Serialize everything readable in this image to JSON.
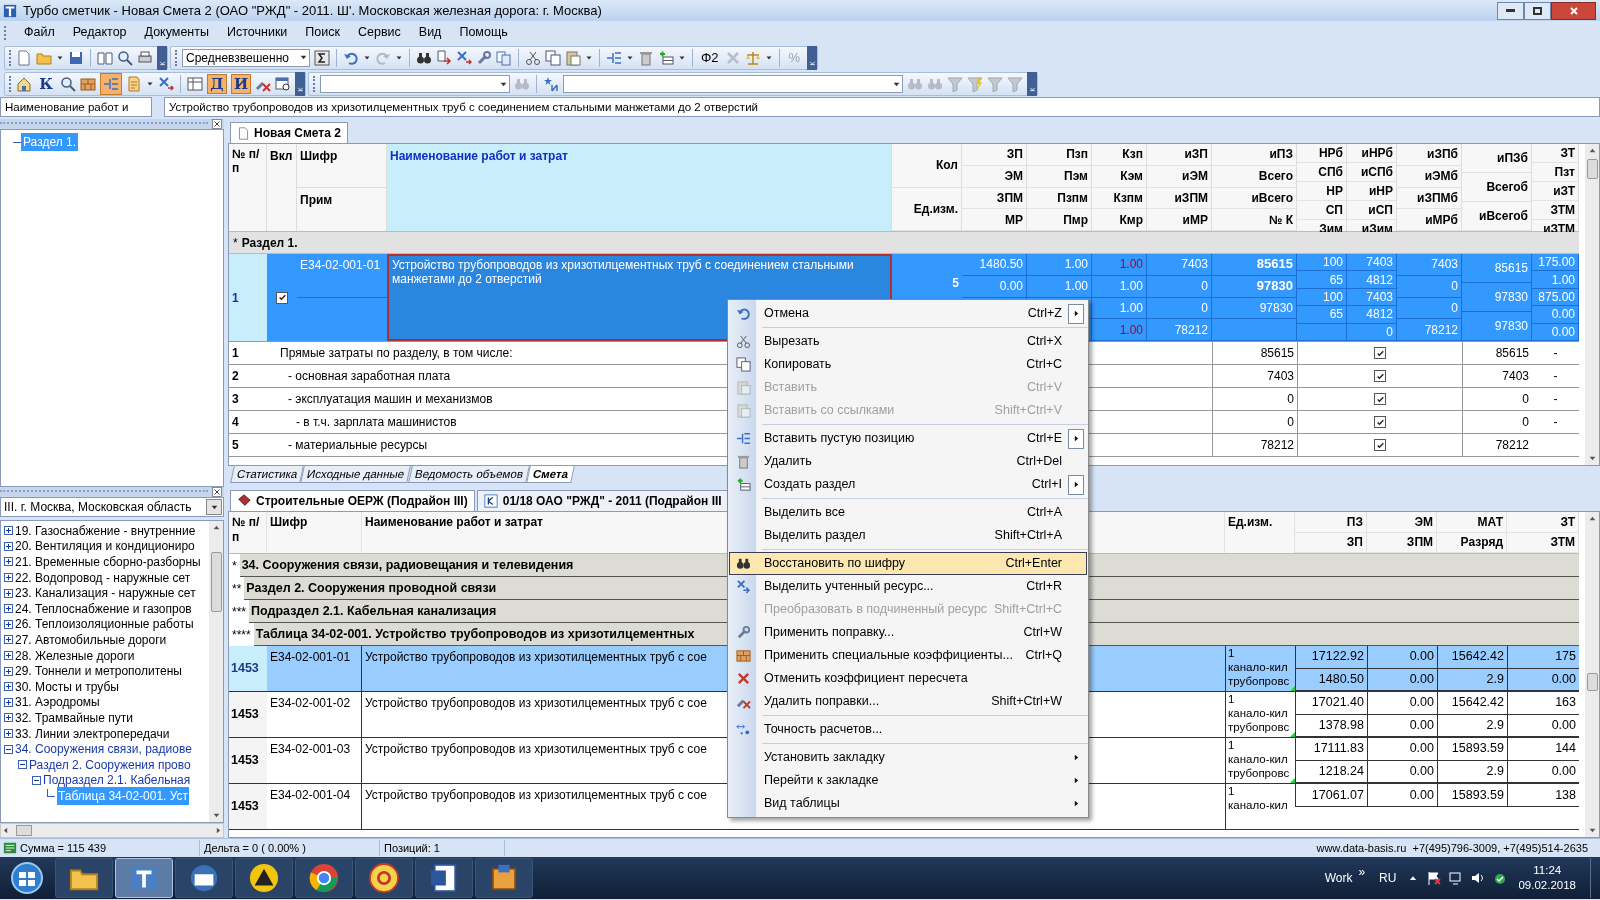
{
  "window": {
    "title": "Турбо сметчик - Новая Смета 2 (ОАО \"РЖД\" - 2011. Ш'. Московская железная дорога: г. Москва)"
  },
  "menu": [
    {
      "label": "Файл"
    },
    {
      "label": "Редактор"
    },
    {
      "label": "Документы"
    },
    {
      "label": "Источники"
    },
    {
      "label": "Поиск"
    },
    {
      "label": "Сервис"
    },
    {
      "label": "Вид"
    },
    {
      "label": "Помощь"
    }
  ],
  "toolbar1": {
    "method_combo": "Средневзвешенно",
    "phi_label": "Φ2",
    "percent_label": "%"
  },
  "toolbar2": {
    "outline_pressed": true,
    "toggles": [
      {
        "label": "К",
        "pressed": false
      },
      {
        "label": "Д",
        "pressed": true
      },
      {
        "label": "И",
        "pressed": true
      }
    ]
  },
  "name_bar": {
    "label": "Наименование работ и",
    "value": "Устройство трубопроводов из хризотилцементных труб с соединением стальными манжетами до 2 отверстий"
  },
  "estimate_tree": [
    {
      "label": "Раздел 1.",
      "selected": true
    }
  ],
  "estimate_tab": {
    "title": "Новая Смета 2"
  },
  "estimate_table": {
    "headers": {
      "num": "№ п/п",
      "incl": "Вкл",
      "code": "Шифр",
      "note": "Прим",
      "name": "Наименование работ и затрат"
    },
    "columns": [
      {
        "labels": [
          "Кол",
          "Ед.изм."
        ]
      },
      {
        "labels": [
          "ЗП",
          "ЭМ",
          "ЗПМ",
          "МР"
        ]
      },
      {
        "labels": [
          "Пзп",
          "Пэм",
          "Пзпм",
          "Пмр"
        ]
      },
      {
        "labels": [
          "Кзп",
          "Кэм",
          "Кзпм",
          "Кмр"
        ]
      },
      {
        "labels": [
          "иЗП",
          "иЭМ",
          "иЗПМ",
          "иМР"
        ]
      },
      {
        "labels": [
          "иПЗ",
          "Всего",
          "иВсего",
          "№ К"
        ]
      },
      {
        "labels": [
          "НРб",
          "СПб",
          "НР",
          "СП",
          "Зим"
        ]
      },
      {
        "labels": [
          "иНРб",
          "иСПб",
          "иНР",
          "иСП",
          "иЗим"
        ]
      },
      {
        "labels": [
          "иЗПб",
          "иЭМб",
          "иЗПМб",
          "иМРб"
        ]
      },
      {
        "labels": [
          "иПЗб",
          "Всегоб",
          "иВсегоб"
        ]
      },
      {
        "labels": [
          "ЗТ",
          "Пзт",
          "иЗТ",
          "ЗТМ",
          "иЗТМ"
        ]
      }
    ],
    "section": {
      "marker": "*",
      "title": "Раздел 1."
    },
    "rows": [
      {
        "num": "1",
        "included": true,
        "selected": true,
        "code": "Е34-02-001-01",
        "name": "Устройство трубопроводов из хризотилцементных труб с соединением стальными манжетами до 2 отверстий",
        "values": [
          [
            "5"
          ],
          [
            "1480.50",
            "0.00"
          ],
          [
            "1.00",
            "1.00"
          ],
          [
            {
              "text": "1.00",
              "flagged": true
            },
            {
              "text": "1.00",
              "flagged": false
            },
            {
              "text": "1.00",
              "flagged": false
            },
            {
              "text": "1.00",
              "flagged": true
            }
          ],
          [
            "7403",
            "0",
            "0",
            "78212"
          ],
          [
            "85615",
            "97830",
            "97830"
          ],
          [
            "100",
            "65",
            "100",
            "65"
          ],
          [
            "7403",
            "4812",
            "7403",
            "4812",
            "0"
          ],
          [
            "7403",
            "0",
            "0",
            "78212"
          ],
          [
            "85615",
            "97830",
            "97830"
          ],
          [
            "175.00",
            "1.00",
            "875.00",
            "0.00",
            "0.00"
          ]
        ]
      }
    ],
    "summary": [
      {
        "num": "1",
        "label": "Прямые затраты по разделу, в том числе:",
        "value": "85615",
        "included": true,
        "total": "85615",
        "dash": "-",
        "children": [
          {
            "num": "2",
            "label": "- основная заработная плата",
            "value": "7403",
            "included": true,
            "total": "7403",
            "dash": "-"
          },
          {
            "num": "3",
            "label": "- эксплуатация машин и механизмов",
            "value": "0",
            "included": true,
            "total": "0",
            "dash": "-",
            "children": [
              {
                "num": "4",
                "label": "- в т.ч. зарплата машинистов",
                "value": "0",
                "included": true,
                "total": "0",
                "dash": "-"
              }
            ]
          },
          {
            "num": "5",
            "label": "- материальные ресурсы",
            "value": "78212",
            "included": true,
            "total": "78212"
          }
        ]
      }
    ]
  },
  "bottom_tabs": [
    {
      "label": "Статистика",
      "selected": false
    },
    {
      "label": "Исходные данные",
      "selected": false
    },
    {
      "label": "Ведомость объемов",
      "selected": false
    },
    {
      "label": "Смета",
      "selected": true
    }
  ],
  "region_combo": "III. г. Москва, Московская область",
  "catalog_tree": [
    {
      "label": "19. Газоснабжение - внутренние",
      "expanded": false,
      "selected": false
    },
    {
      "label": "20. Вентиляция и кондициониро",
      "expanded": false,
      "selected": false
    },
    {
      "label": "21. Временные сборно-разборны",
      "expanded": false,
      "selected": false
    },
    {
      "label": "22. Водопровод - наружные сет",
      "expanded": false,
      "selected": false
    },
    {
      "label": "23. Канализация - наружные сет",
      "expanded": false,
      "selected": false
    },
    {
      "label": "24. Теплоснабжение и газопров",
      "expanded": false,
      "selected": false
    },
    {
      "label": "26. Теплоизоляционные работы",
      "expanded": false,
      "selected": false
    },
    {
      "label": "27. Автомобильные дороги",
      "expanded": false,
      "selected": false
    },
    {
      "label": "28. Железные дороги",
      "expanded": false,
      "selected": false
    },
    {
      "label": "29. Тоннели и метрополитены",
      "expanded": false,
      "selected": false
    },
    {
      "label": "30. Мосты и трубы",
      "expanded": false,
      "selected": false
    },
    {
      "label": "31. Аэродромы",
      "expanded": false,
      "selected": false
    },
    {
      "label": "32. Трамвайные пути",
      "expanded": false,
      "selected": false
    },
    {
      "label": "33. Линии электропередачи",
      "expanded": false,
      "selected": false
    },
    {
      "label": "34. Сооружения связи, радиове",
      "expanded": true,
      "selected": false,
      "children": [
        {
          "label": "Раздел 2. Сооружения прово",
          "expanded": true,
          "selected": false,
          "children": [
            {
              "label": "Подраздел 2.1. Кабельная",
              "expanded": true,
              "selected": false,
              "children": [
                {
                  "label": "Таблица 34-02-001. Уст",
                  "selected": true
                }
              ]
            }
          ]
        }
      ]
    }
  ],
  "lower_tabs": [
    {
      "label": "Строительные ОЕРЖ (Подрайон III)",
      "selected": true
    },
    {
      "label": "01/18 ОАО \"РЖД\" - 2011 (Подрайон III",
      "selected": false
    }
  ],
  "catalog_table": {
    "columns": [
      {
        "labels": [
          "№ п/п"
        ]
      },
      {
        "labels": [
          "Шифр"
        ]
      },
      {
        "labels": [
          "Наименование работ и затрат"
        ]
      },
      {
        "labels": [
          "Ед.изм."
        ]
      },
      {
        "labels": [
          "ПЗ",
          "ЗП"
        ]
      },
      {
        "labels": [
          "ЭМ",
          "ЗПМ"
        ]
      },
      {
        "labels": [
          "МАТ",
          "Разряд"
        ]
      },
      {
        "labels": [
          "ЗТ",
          "ЗТМ"
        ]
      }
    ],
    "groups": [
      {
        "marker": "*",
        "title": "34. Сооружения связи, радиовещания и телевидения",
        "children": [
          {
            "marker": "**",
            "title": "Раздел 2. Сооружения проводной связи",
            "children": [
              {
                "marker": "***",
                "title": "Подраздел 2.1. Кабельная канализация",
                "children": [
                  {
                    "marker": "****",
                    "title": "Таблица 34-02-001. Устройство трубопроводов из хризотилцементных"
                  }
                ]
              }
            ]
          }
        ]
      }
    ],
    "rows": [
      {
        "num": "1453",
        "code": "Е34-02-001-01",
        "name": "Устройство трубопроводов из хризотилцементных труб с сое",
        "selected": true,
        "unit": [
          "1",
          "канало-кил",
          "трубопровс"
        ],
        "values": [
          [
            "17122.92",
            "1480.50"
          ],
          [
            "0.00",
            "0.00"
          ],
          [
            "15642.42",
            "2.9"
          ],
          [
            "175",
            "0.00"
          ]
        ]
      },
      {
        "num": "1453",
        "code": "Е34-02-001-02",
        "name": "Устройство трубопроводов из хризотилцементных труб с сое",
        "selected": false,
        "unit": [
          "1",
          "канало-кил",
          "трубопровс"
        ],
        "values": [
          [
            "17021.40",
            "1378.98"
          ],
          [
            "0.00",
            "0.00"
          ],
          [
            "15642.42",
            "2.9"
          ],
          [
            "163",
            "0.00"
          ]
        ]
      },
      {
        "num": "1453",
        "code": "Е34-02-001-03",
        "name": "Устройство трубопроводов из хризотилцементных труб с сое",
        "selected": false,
        "unit": [
          "1",
          "канало-кил",
          "трубопровс"
        ],
        "values": [
          [
            "17111.83",
            "1218.24"
          ],
          [
            "0.00",
            "0.00"
          ],
          [
            "15893.59",
            "2.9"
          ],
          [
            "144",
            "0.00"
          ]
        ]
      },
      {
        "num": "1453",
        "code": "Е34-02-001-04",
        "name": "Устройство трубопроводов из хризотилцементных труб с сое",
        "selected": false,
        "unit": [
          "1",
          "канало-кил"
        ],
        "values": [
          [
            "17061.07"
          ],
          [
            "0.00"
          ],
          [
            "15893.59"
          ],
          [
            "138"
          ]
        ]
      }
    ]
  },
  "context_menu": [
    {
      "kind": "item",
      "label": "Отмена",
      "shortcut": "Ctrl+Z",
      "submenu": true,
      "boxed": true,
      "disabled": false,
      "selected": false
    },
    {
      "kind": "separator"
    },
    {
      "kind": "item",
      "label": "Вырезать",
      "shortcut": "Ctrl+X",
      "disabled": false,
      "selected": false
    },
    {
      "kind": "item",
      "label": "Копировать",
      "shortcut": "Ctrl+C",
      "disabled": false,
      "selected": false
    },
    {
      "kind": "item",
      "label": "Вставить",
      "shortcut": "Ctrl+V",
      "disabled": true,
      "selected": false
    },
    {
      "kind": "item",
      "label": "Вставить со ссылками",
      "shortcut": "Shift+Ctrl+V",
      "disabled": true,
      "selected": false
    },
    {
      "kind": "separator"
    },
    {
      "kind": "item",
      "label": "Вставить пустую позицию",
      "shortcut": "Ctrl+E",
      "submenu": true,
      "boxed": true,
      "disabled": false,
      "selected": false
    },
    {
      "kind": "item",
      "label": "Удалить",
      "shortcut": "Ctrl+Del",
      "disabled": false,
      "selected": false
    },
    {
      "kind": "item",
      "label": "Создать раздел",
      "shortcut": "Ctrl+I",
      "submenu": true,
      "boxed": true,
      "disabled": false,
      "selected": false
    },
    {
      "kind": "separator"
    },
    {
      "kind": "item",
      "label": "Выделить все",
      "shortcut": "Ctrl+A",
      "disabled": false,
      "selected": false
    },
    {
      "kind": "item",
      "label": "Выделить раздел",
      "shortcut": "Shift+Ctrl+A",
      "disabled": false,
      "selected": false
    },
    {
      "kind": "separator"
    },
    {
      "kind": "item",
      "label": "Восстановить по шифру",
      "shortcut": "Ctrl+Enter",
      "disabled": false,
      "selected": true
    },
    {
      "kind": "item",
      "label": "Выделить учтенный ресурс...",
      "shortcut": "Ctrl+R",
      "disabled": false,
      "selected": false
    },
    {
      "kind": "item",
      "label": "Преобразовать в подчиненный ресурс",
      "shortcut": "Shift+Ctrl+C",
      "disabled": true,
      "selected": false
    },
    {
      "kind": "item",
      "label": "Применить поправку...",
      "shortcut": "Ctrl+W",
      "disabled": false,
      "selected": false
    },
    {
      "kind": "item",
      "label": "Применить специальные коэффициенты...",
      "shortcut": "Ctrl+Q",
      "disabled": false,
      "selected": false
    },
    {
      "kind": "item",
      "label": "Отменить коэффициент пересчета",
      "disabled": false,
      "selected": false
    },
    {
      "kind": "item",
      "label": "Удалить поправки...",
      "shortcut": "Shift+Ctrl+W",
      "disabled": false,
      "selected": false
    },
    {
      "kind": "separator"
    },
    {
      "kind": "item",
      "label": "Точность расчетов...",
      "disabled": false,
      "selected": false
    },
    {
      "kind": "separator"
    },
    {
      "kind": "item",
      "label": "Установить закладку",
      "submenu": true,
      "boxed": false,
      "disabled": false,
      "selected": false
    },
    {
      "kind": "item",
      "label": "Перейти к закладке",
      "submenu": true,
      "boxed": false,
      "disabled": false,
      "selected": false
    },
    {
      "kind": "item",
      "label": "Вид таблицы",
      "submenu": true,
      "boxed": false,
      "disabled": false,
      "selected": false
    }
  ],
  "status_bar": {
    "sum": "Сумма = 115 439",
    "delta": "Дельта = 0 ( 0.00% )",
    "positions": "Позиций: 1",
    "contacts": "www.data-basis.ru  +7(495)796-3009, +7(495)514-2635"
  },
  "taskbar": {
    "apps": [
      {
        "selected": false
      },
      {
        "selected": true
      },
      {
        "selected": false
      },
      {
        "selected": false
      },
      {
        "selected": false
      },
      {
        "selected": false
      },
      {
        "selected": false
      },
      {
        "selected": false
      }
    ],
    "toolbar_label": "Work",
    "chevron": "»",
    "language": "RU",
    "time": "11:24",
    "date": "09.02.2018"
  }
}
